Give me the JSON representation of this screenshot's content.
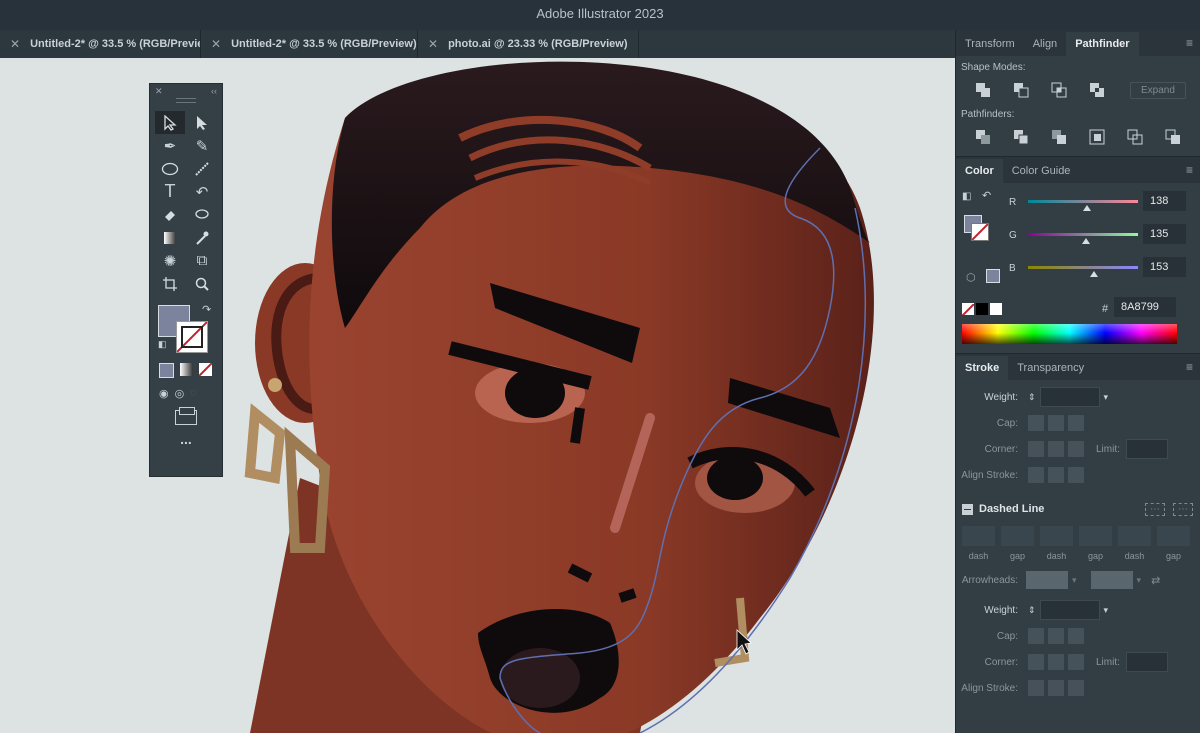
{
  "app": {
    "title": "Adobe Illustrator 2023"
  },
  "tabs": [
    {
      "label": "Untitled-2* @ 33.5 % (RGB/Previe"
    },
    {
      "label": "Untitled-2* @ 33.5 % (RGB/Preview)"
    },
    {
      "label": "photo.ai @ 23.33 % (RGB/Preview)"
    }
  ],
  "transform_panel": {
    "tabs": [
      "Transform",
      "Align",
      "Pathfinder"
    ],
    "active_tab": "Pathfinder",
    "shape_modes_label": "Shape Modes:",
    "expand_label": "Expand",
    "pathfinders_label": "Pathfinders:"
  },
  "color_panel": {
    "tabs": [
      "Color",
      "Color Guide"
    ],
    "r_label": "R",
    "r_value": "138",
    "r_fraction": 0.54,
    "g_label": "G",
    "g_value": "135",
    "g_fraction": 0.53,
    "b_label": "B",
    "b_value": "153",
    "b_fraction": 0.6,
    "hex_prefix": "#",
    "hex_value": "8A8799",
    "fill_color": "#8A8799"
  },
  "stroke_panel": {
    "tabs": [
      "Stroke",
      "Transparency"
    ],
    "weight_label": "Weight:",
    "cap_label": "Cap:",
    "corner_label": "Corner:",
    "limit_label": "Limit:",
    "align_label": "Align Stroke:",
    "dashed_label": "Dashed Line",
    "dash_labels": [
      "dash",
      "gap",
      "dash",
      "gap",
      "dash",
      "gap"
    ],
    "arrowheads_label": "Arrowheads:",
    "weight2_label": "Weight:",
    "cap2_label": "Cap:",
    "corner2_label": "Corner:",
    "limit2_label": "Limit:",
    "align2_label": "Align Stroke:"
  },
  "tools": {
    "more_label": "..."
  },
  "colors": {
    "accent": "#8A8799",
    "skin": "#8f3d28",
    "hair": "#150d10",
    "gold": "#b08e61"
  }
}
